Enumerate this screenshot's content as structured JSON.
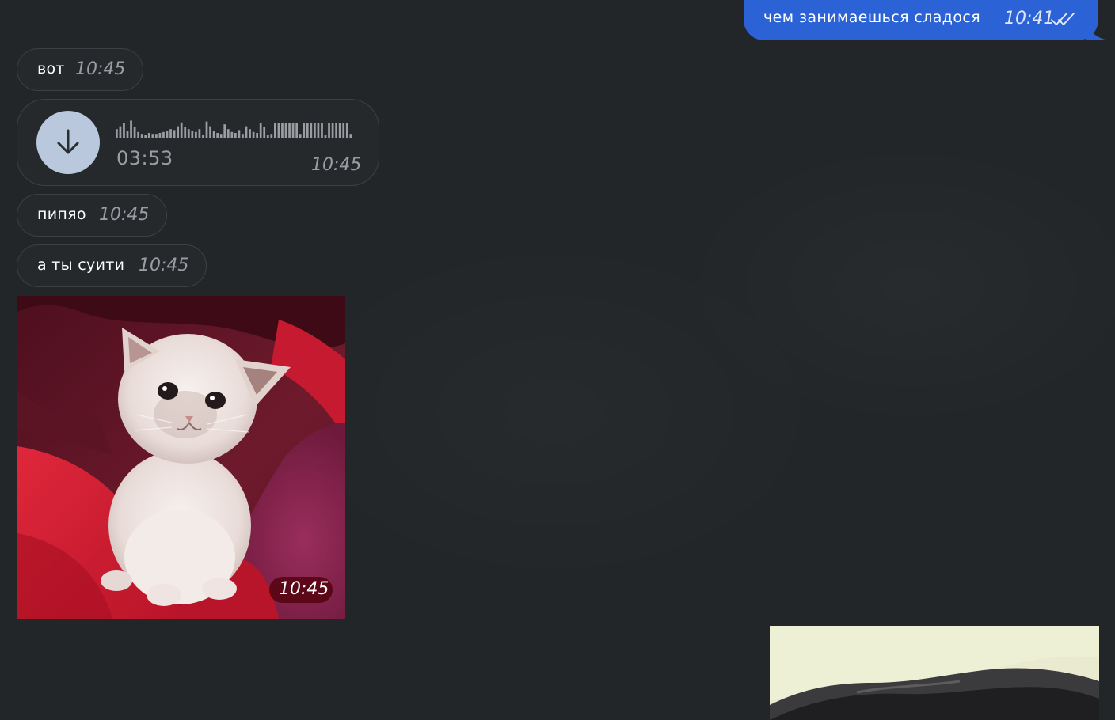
{
  "outgoing": {
    "text": "чем занимаешься сладося",
    "time": "10:41",
    "status_icon": "double-check-icon",
    "bubble_color": "#2b62d5"
  },
  "messages": [
    {
      "text": "вот",
      "time": "10:45"
    },
    {
      "text": "пипяо",
      "time": "10:45"
    },
    {
      "text": "а ты суити",
      "time": "10:45"
    }
  ],
  "voice": {
    "duration": "03:53",
    "time": "10:45",
    "icon": "download-arrow-icon",
    "button_color": "#b9c8dd"
  },
  "photo": {
    "subject": "kitten",
    "time": "10:45"
  },
  "colors": {
    "background": "#232629",
    "incoming_bubble": "#26292c",
    "incoming_border": "#3c4044",
    "timestamp": "#9a9ea3"
  }
}
